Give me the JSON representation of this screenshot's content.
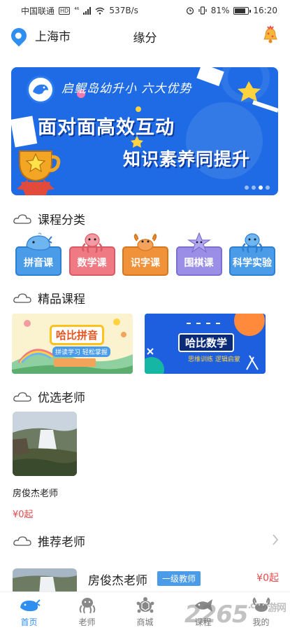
{
  "statusbar": {
    "carrier": "中国联通",
    "hd": "HD",
    "net": "⁴⁶",
    "speed": "537B/s",
    "battery": "81%",
    "battery_level": 0.81,
    "time": "16:20"
  },
  "topbar": {
    "city": "上海市",
    "title": "缘分"
  },
  "banner": {
    "tagline": "启鲲岛幼升小 六大优势",
    "headline": "面对面高效互动",
    "subline": "知识素养同提升",
    "active_dot": 3,
    "dot_count": 4
  },
  "sections": {
    "categories": "课程分类",
    "premium": "精品课程",
    "selected_teachers": "优选老师",
    "recommended_teachers": "推荐老师"
  },
  "categories": [
    {
      "label": "拼音课",
      "color": "#4a9be8",
      "border": "#2d7fd0",
      "animal": "whale-icon"
    },
    {
      "label": "数学课",
      "color": "#f07a83",
      "border": "#d95a64",
      "animal": "octopus-icon"
    },
    {
      "label": "识字课",
      "color": "#f0923a",
      "border": "#d6761f",
      "animal": "crab-icon"
    },
    {
      "label": "围棋课",
      "color": "#9b8ee6",
      "border": "#7d6fd0",
      "animal": "starfish-icon"
    },
    {
      "label": "科学实验",
      "color": "#4a9be8",
      "border": "#2d7fd0",
      "animal": "octopus-icon"
    }
  ],
  "courses": [
    {
      "title": "哈比拼音",
      "subtitle": "拼读学习 轻松掌握"
    },
    {
      "title": "哈比数学",
      "subtitle": "思维训练 逻辑启蒙"
    }
  ],
  "featured_teacher": {
    "name": "房俊杰老师",
    "price": "¥0起"
  },
  "recommended_teacher": {
    "name": "房俊杰老师",
    "badge": "一级教师",
    "price": "¥0起"
  },
  "tabs": [
    {
      "label": "首页",
      "icon": "whale-icon",
      "active": true
    },
    {
      "label": "老师",
      "icon": "octopus-icon",
      "active": false
    },
    {
      "label": "商城",
      "icon": "turtle-icon",
      "active": false
    },
    {
      "label": "课程",
      "icon": "fish-icon",
      "active": false
    },
    {
      "label": "我的",
      "icon": "crab-icon",
      "active": false
    }
  ],
  "watermark": {
    "text": "2265",
    "suffix": ".com",
    "site": "游网"
  },
  "colors": {
    "accent": "#2f8ff0",
    "price": "#e84a4a",
    "banner_bg": "#1e6be5"
  }
}
